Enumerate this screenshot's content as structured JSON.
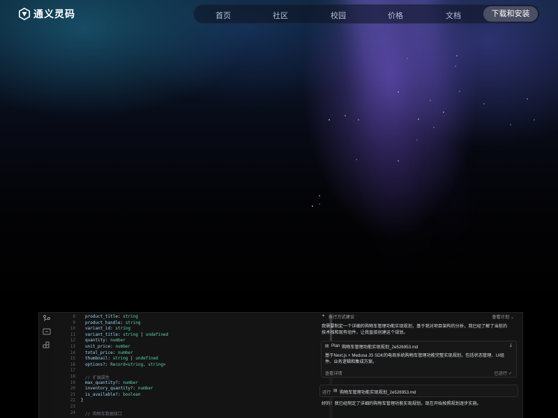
{
  "brand": {
    "name": "通义灵码",
    "logo_icon": "tongyi-lingma-logo-icon"
  },
  "nav": {
    "items": [
      "首页",
      "社区",
      "校园",
      "价格",
      "文档"
    ],
    "download_label": "下载和安装"
  },
  "ide": {
    "code_lines": [
      {
        "n": "8",
        "parts": [
          [
            "product_title",
            "k"
          ],
          [
            ": ",
            ""
          ],
          [
            "string",
            "t"
          ]
        ]
      },
      {
        "n": "9",
        "parts": [
          [
            "product_handle",
            "k"
          ],
          [
            ": ",
            ""
          ],
          [
            "string",
            "t"
          ]
        ]
      },
      {
        "n": "10",
        "parts": [
          [
            "variant_id",
            "k"
          ],
          [
            ": ",
            ""
          ],
          [
            "string",
            "t"
          ]
        ]
      },
      {
        "n": "11",
        "parts": [
          [
            "variant_title",
            "k"
          ],
          [
            ": ",
            ""
          ],
          [
            "string",
            "t"
          ],
          [
            " | ",
            ""
          ],
          [
            "undefined",
            "t"
          ]
        ]
      },
      {
        "n": "12",
        "parts": [
          [
            "quantity",
            "k"
          ],
          [
            ": ",
            ""
          ],
          [
            "number",
            "t"
          ]
        ]
      },
      {
        "n": "13",
        "parts": [
          [
            "unit_price",
            "k"
          ],
          [
            ": ",
            ""
          ],
          [
            "number",
            "t"
          ]
        ]
      },
      {
        "n": "14",
        "parts": [
          [
            "total_price",
            "k"
          ],
          [
            ": ",
            ""
          ],
          [
            "number",
            "t"
          ]
        ]
      },
      {
        "n": "15",
        "parts": [
          [
            "thumbnail",
            "k"
          ],
          [
            ": ",
            ""
          ],
          [
            "string",
            "t"
          ],
          [
            " | ",
            ""
          ],
          [
            "undefined",
            "t"
          ]
        ]
      },
      {
        "n": "16",
        "parts": [
          [
            "options?",
            "k"
          ],
          [
            ": ",
            ""
          ],
          [
            "Record<string, string>",
            "t"
          ]
        ]
      },
      {
        "n": "17",
        "parts": []
      },
      {
        "n": "18",
        "parts": [
          [
            "// 扩展属性",
            "c"
          ]
        ]
      },
      {
        "n": "19",
        "parts": [
          [
            "max_quantity?",
            "k"
          ],
          [
            ": ",
            ""
          ],
          [
            "number",
            "t"
          ]
        ]
      },
      {
        "n": "20",
        "parts": [
          [
            "inventory_quantity?",
            "k"
          ],
          [
            ": ",
            ""
          ],
          [
            "number",
            "t"
          ]
        ]
      },
      {
        "n": "21",
        "parts": [
          [
            "is_available?",
            "k"
          ],
          [
            ": ",
            ""
          ],
          [
            "boolean",
            "t"
          ]
        ]
      },
      {
        "n": "22",
        "parts": [
          [
            "}",
            ""
          ]
        ]
      },
      {
        "n": "23",
        "parts": []
      },
      {
        "n": "24",
        "parts": [
          [
            "// 购物车数据接口",
            "c"
          ]
        ]
      }
    ],
    "chat": {
      "header_left": "执行方式建议",
      "header_right": "查看计划 ⌄",
      "intro": [
        "我需要制定一个详细的购物车管理功能实现规划，基于我对项目架构的分析，我已经了解了当前的",
        "技术栈和现有组件，让我直接创建这个规划。"
      ],
      "plan_label": "Plan",
      "plan_file": "购物车管理功能实现规划_2e526953.md",
      "plan_desc": [
        "基于Next.js + Medusa JS SDK的电商系统购物车管理功能完整实现规划，包括状态管理、UI组",
        "件、业务逻辑和集成方案。"
      ],
      "plan_detail": "查看详情",
      "plan_status": "已运行 ✓",
      "run_label": "运行",
      "run_file": "购物车管理功能实现规划_2e526953.md",
      "reply": "好的！我已经制定了详细的购物车管理功能实现规划。现在开始按照规划逐步实施。"
    }
  }
}
